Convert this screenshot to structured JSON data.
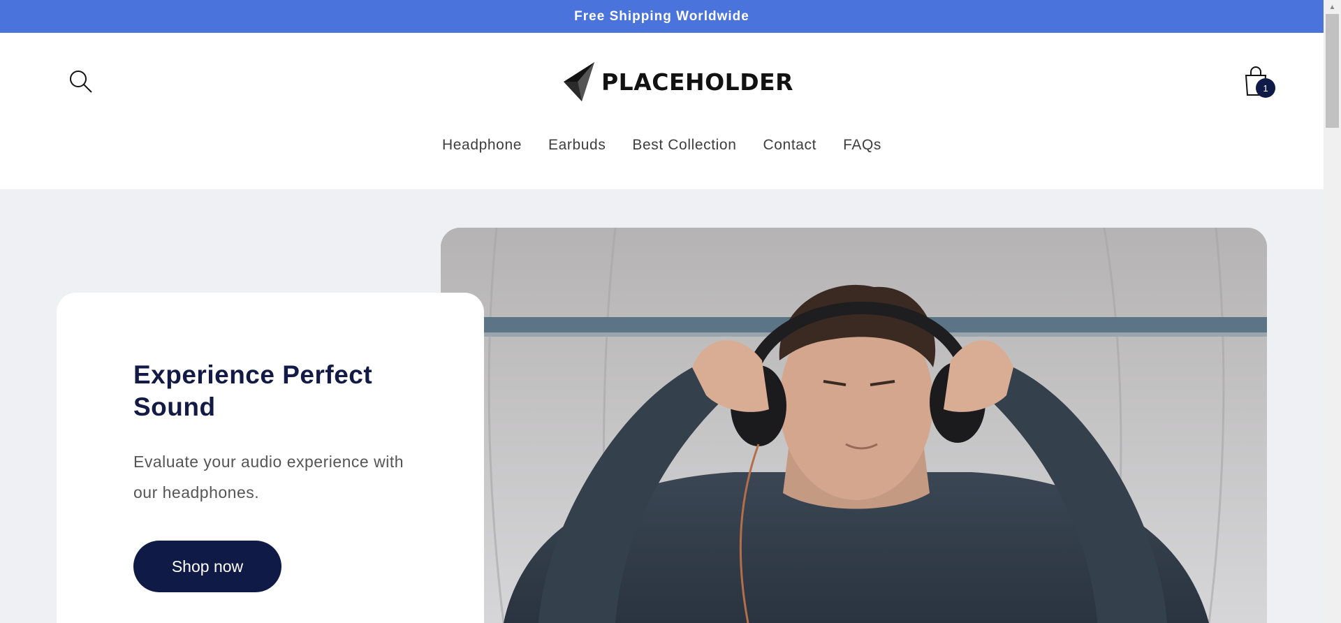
{
  "announcement": {
    "text": "Free Shipping Worldwide"
  },
  "header": {
    "logo_text": "PLACEHOLDER",
    "search_icon": "search-icon",
    "cart_icon": "shopping-bag-icon",
    "cart_count": "1"
  },
  "nav": {
    "items": [
      {
        "label": "Headphone"
      },
      {
        "label": "Earbuds"
      },
      {
        "label": "Best Collection"
      },
      {
        "label": "Contact"
      },
      {
        "label": "FAQs"
      }
    ]
  },
  "hero": {
    "title": "Experience Perfect Sound",
    "subtitle": "Evaluate your audio experience with our headphones.",
    "button_label": "Shop now"
  },
  "colors": {
    "announcement_bg": "#4a74dc",
    "primary": "#0f1b46",
    "page_bg": "#eff0f4"
  }
}
